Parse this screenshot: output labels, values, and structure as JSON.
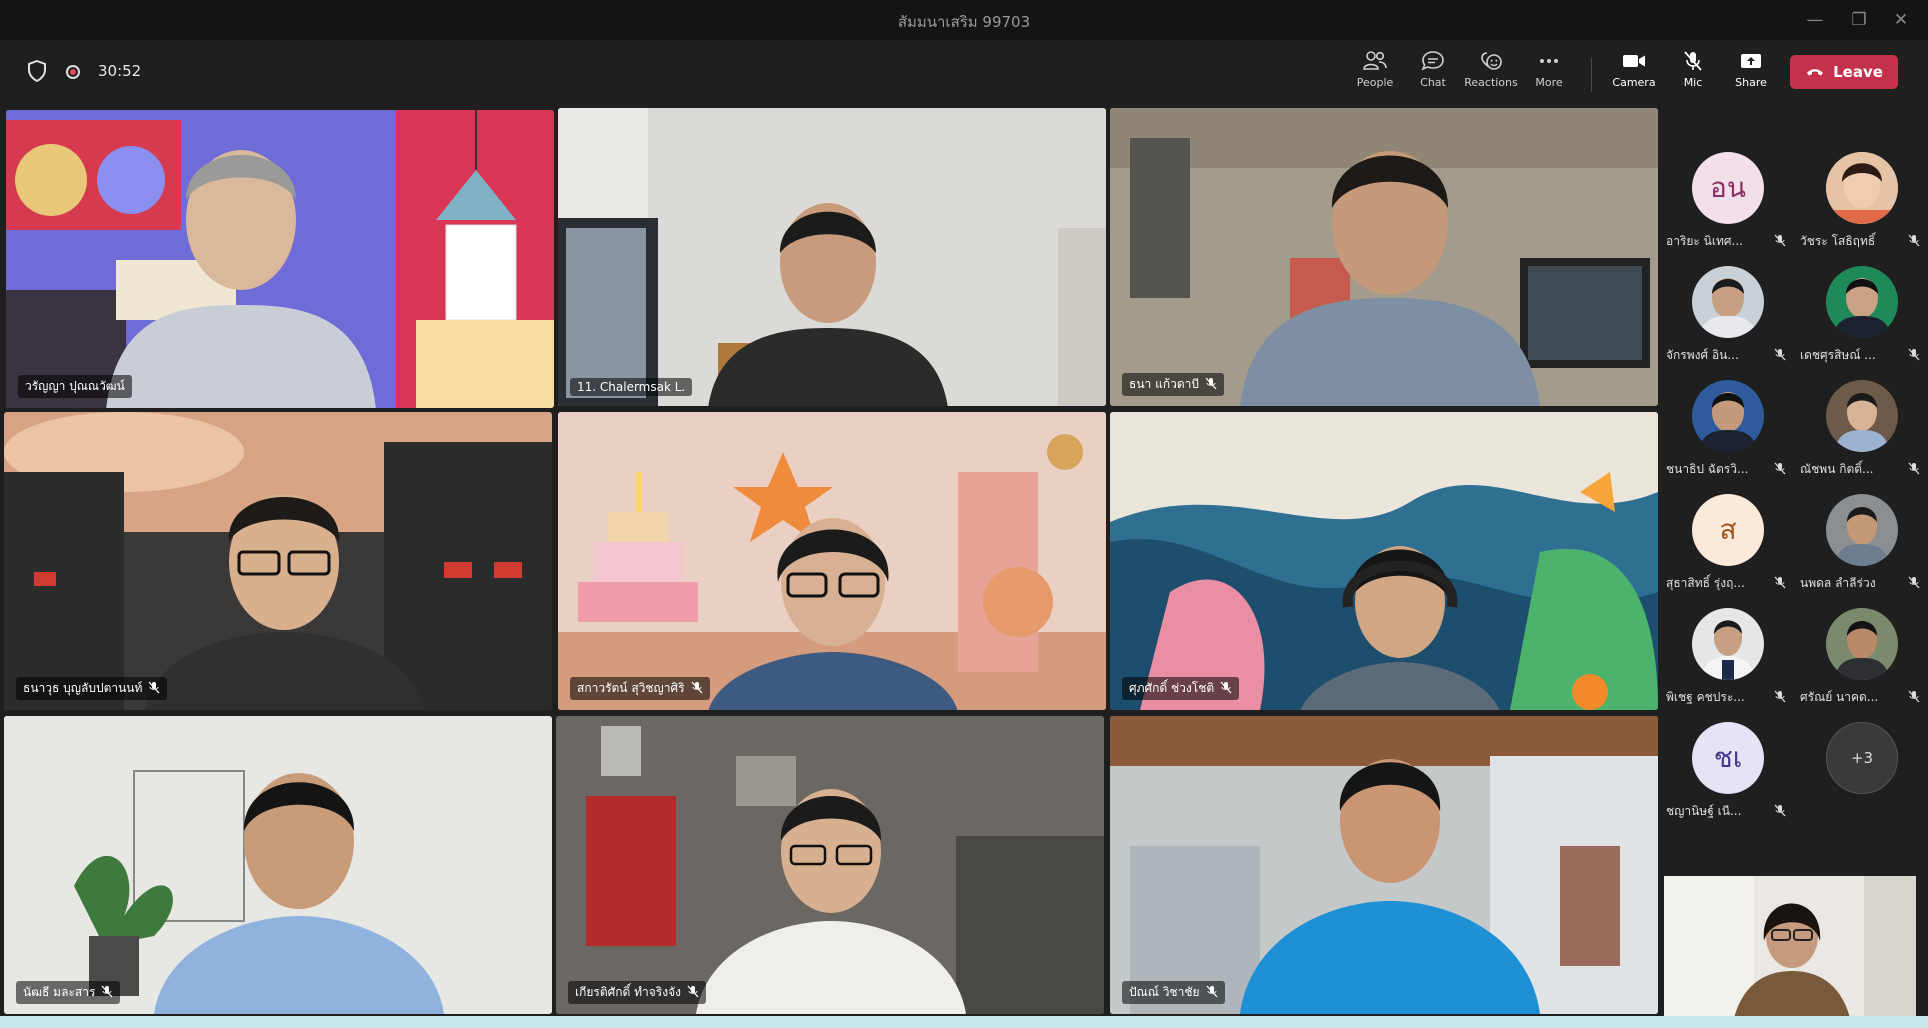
{
  "window": {
    "title": "สัมมนาเสริม 99703"
  },
  "toolbar": {
    "timer": "30:52",
    "people_label": "People",
    "chat_label": "Chat",
    "reactions_label": "Reactions",
    "more_label": "More",
    "camera_label": "Camera",
    "mic_label": "Mic",
    "share_label": "Share",
    "leave_label": "Leave",
    "leave_color": "#c4314b"
  },
  "grid": {
    "tiles": [
      {
        "name": "วรัญญา ปุณณวัฒน์",
        "muted": false,
        "active": true
      },
      {
        "name": "11. Chalermsak L.",
        "muted": false
      },
      {
        "name": "ธนา แก้วดาบี",
        "muted": true
      },
      {
        "name": "ธนาวุธ บุญลับปตานนท์",
        "muted": true
      },
      {
        "name": "สกาวรัตน์ สุวิชญาศิริ",
        "muted": true
      },
      {
        "name": "ศุภศักดิ์ ช่วงโชติ",
        "muted": true
      },
      {
        "name": "นัฒธี มละสาร",
        "muted": true
      },
      {
        "name": "เกียรติศักดิ์ ทำจริงจัง",
        "muted": true
      },
      {
        "name": "ปัณณ์ วิชาชัย",
        "muted": true
      }
    ]
  },
  "participants": [
    {
      "name": "อาริยะ นิเทศ...",
      "initials": "อน",
      "avatar_color": "#f2dfe9",
      "text_color": "#8a2f5f"
    },
    {
      "name": "วัชระ โสธิฤทธิ์",
      "photo": true
    },
    {
      "name": "จักรพงศ์ อิน...",
      "photo": true
    },
    {
      "name": "เดชศุรสิษณ์ ...",
      "photo": true
    },
    {
      "name": "ชนาธิป ฉัตรวิ...",
      "photo": true
    },
    {
      "name": "ณัชพน กิตติ์...",
      "photo": true
    },
    {
      "name": "สุธาสิทธิ์ รุ่งฤ...",
      "initials": "ส",
      "avatar_color": "#fbe9d9",
      "text_color": "#a0531e"
    },
    {
      "name": "นพดล ลำลีร่วง",
      "photo": true
    },
    {
      "name": "พิเชฐ คชประ...",
      "photo": true
    },
    {
      "name": "ศรัณย์ นาคด...",
      "photo": true
    },
    {
      "name": "ชญานิษฐ์ เนี...",
      "initials": "ชเ",
      "avatar_color": "#e6e3f7",
      "text_color": "#433a8c"
    }
  ],
  "overflow": {
    "label": "+3"
  }
}
